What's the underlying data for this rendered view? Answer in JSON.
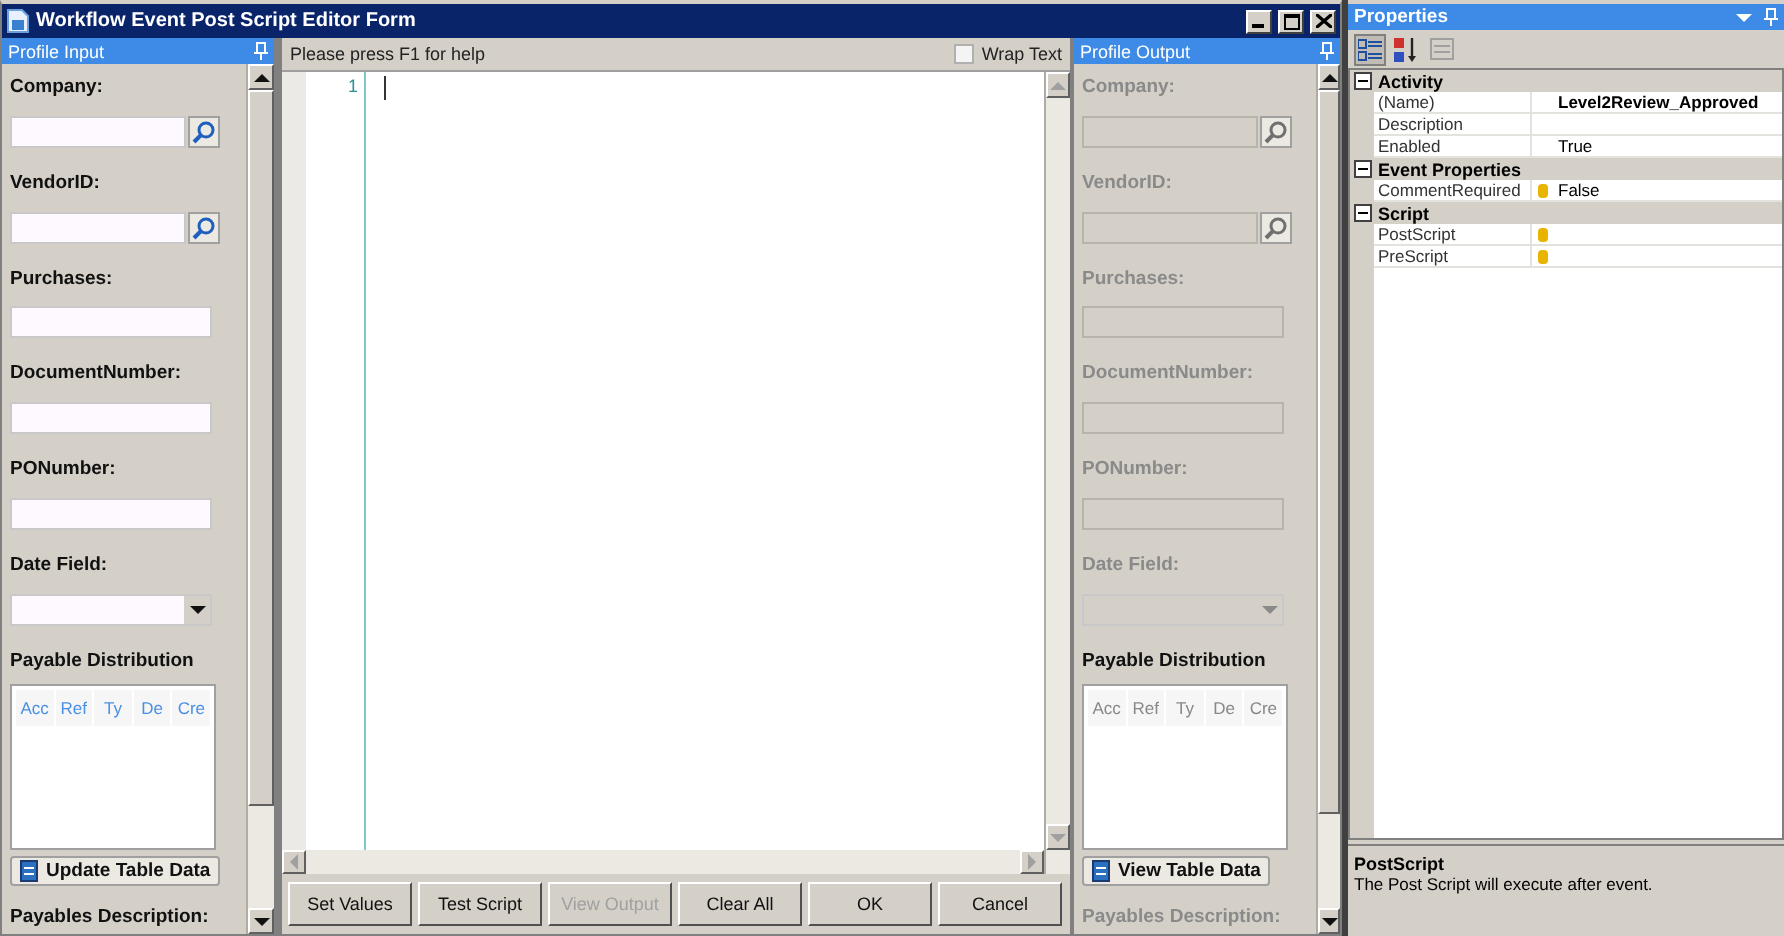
{
  "window": {
    "title": "Workflow Event Post Script Editor Form"
  },
  "panels": [
    {
      "title": "Profile Input",
      "disabled": false,
      "fields": [
        {
          "label": "Company:",
          "kind": "lookup"
        },
        {
          "label": "VendorID:",
          "kind": "lookup"
        },
        {
          "label": "Purchases:",
          "kind": "text"
        },
        {
          "label": "DocumentNumber:",
          "kind": "text"
        },
        {
          "label": "PONumber:",
          "kind": "text"
        },
        {
          "label": "Date Field:",
          "kind": "date"
        }
      ],
      "distribution": {
        "label": "Payable Distribution",
        "columns": [
          "Acc",
          "Ref",
          "Ty",
          "De",
          "Cre"
        ]
      },
      "button": "Update Table Data",
      "footer": "Payables Description:"
    },
    {
      "title": "Profile Output",
      "disabled": true,
      "fields": [
        {
          "label": "Company:",
          "kind": "lookup"
        },
        {
          "label": "VendorID:",
          "kind": "lookup"
        },
        {
          "label": "Purchases:",
          "kind": "text"
        },
        {
          "label": "DocumentNumber:",
          "kind": "text"
        },
        {
          "label": "PONumber:",
          "kind": "text"
        },
        {
          "label": "Date Field:",
          "kind": "date"
        }
      ],
      "distribution": {
        "label": "Payable Distribution",
        "columns": [
          "Acc",
          "Ref",
          "Ty",
          "De",
          "Cre"
        ]
      },
      "button": "View Table Data",
      "footer": "Payables Description:"
    }
  ],
  "editor": {
    "hint": "Please press F1 for help",
    "wrap_text": {
      "label": "Wrap Text",
      "checked": false
    },
    "line_numbers": [
      "1"
    ]
  },
  "buttons": [
    {
      "label": "Set Values",
      "disabled": false
    },
    {
      "label": "Test Script",
      "disabled": false
    },
    {
      "label": "View Output",
      "disabled": true
    },
    {
      "label": "Clear All",
      "disabled": false
    },
    {
      "label": "OK",
      "disabled": false
    },
    {
      "label": "Cancel",
      "disabled": false
    }
  ],
  "properties": {
    "title": "Properties",
    "toolbar": [
      {
        "kind": "categorized",
        "selected": true,
        "disabled": false
      },
      {
        "kind": "alphabetical",
        "selected": false,
        "disabled": false
      },
      {
        "kind": "pages",
        "selected": false,
        "disabled": true
      }
    ],
    "categories": [
      {
        "name": "Activity",
        "expanded": true,
        "rows": [
          {
            "name": "(Name)",
            "value": "Level2Review_Approved",
            "bold": true,
            "marker": false
          },
          {
            "name": "Description",
            "marker": false
          },
          {
            "name": "Enabled",
            "value": "True",
            "bold": false,
            "marker": false
          }
        ]
      },
      {
        "name": "Event Properties",
        "expanded": true,
        "rows": [
          {
            "name": "CommentRequired",
            "value": "False",
            "bold": false,
            "marker": true
          }
        ]
      },
      {
        "name": "Script",
        "expanded": true,
        "rows": [
          {
            "name": "PostScript",
            "marker": true
          },
          {
            "name": "PreScript",
            "marker": true
          }
        ]
      }
    ],
    "description": {
      "title": "PostScript",
      "text": "The Post Script will execute after event."
    }
  }
}
